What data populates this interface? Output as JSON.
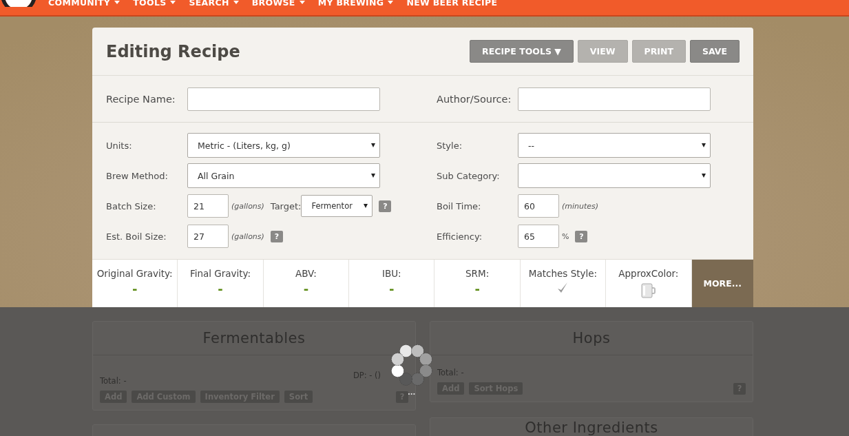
{
  "nav": {
    "items": [
      {
        "label": "COMMUNITY",
        "dropdown": true
      },
      {
        "label": "TOOLS",
        "dropdown": true
      },
      {
        "label": "SEARCH",
        "dropdown": true
      },
      {
        "label": "BROWSE",
        "dropdown": true
      },
      {
        "label": "MY BREWING",
        "dropdown": true
      },
      {
        "label": "NEW BEER RECIPE",
        "dropdown": false
      }
    ]
  },
  "editor": {
    "title": "Editing Recipe",
    "buttons": [
      {
        "label": "RECIPE TOOLS ▼",
        "disabled": false
      },
      {
        "label": "VIEW",
        "disabled": true
      },
      {
        "label": "PRINT",
        "disabled": true
      },
      {
        "label": "SAVE",
        "disabled": false
      }
    ],
    "name_row": [
      {
        "label": "Recipe Name:"
      },
      {
        "label": "Author/Source:"
      }
    ],
    "left_fields": [
      {
        "label": "Units:",
        "parts": [
          {
            "kind": "select",
            "value": "Metric - (Liters, kg, g)"
          }
        ]
      },
      {
        "label": "Brew Method:",
        "parts": [
          {
            "kind": "select",
            "value": "All Grain"
          }
        ]
      },
      {
        "label": "Batch Size:",
        "parts": [
          {
            "kind": "input",
            "value": "21"
          },
          {
            "kind": "unit",
            "text": "(gallons)"
          },
          {
            "kind": "label",
            "text": "Target:"
          },
          {
            "kind": "select",
            "value": "Fermentor"
          },
          {
            "kind": "help",
            "text": "?"
          }
        ]
      },
      {
        "label": "Est. Boil Size:",
        "parts": [
          {
            "kind": "input",
            "value": "27"
          },
          {
            "kind": "unit",
            "text": "(gallons)"
          },
          {
            "kind": "help",
            "text": "?"
          }
        ]
      }
    ],
    "right_fields": [
      {
        "label": "Style:",
        "parts": [
          {
            "kind": "select",
            "value": "--"
          }
        ]
      },
      {
        "label": "Sub Category:",
        "parts": [
          {
            "kind": "select"
          }
        ]
      },
      {
        "label": "Boil Time:",
        "parts": [
          {
            "kind": "input",
            "value": "60"
          },
          {
            "kind": "unit",
            "text": "(minutes)"
          }
        ]
      },
      {
        "label": "Efficiency:",
        "parts": [
          {
            "kind": "input",
            "value": "65"
          },
          {
            "kind": "suffix",
            "text": "%"
          },
          {
            "kind": "help",
            "text": "?"
          }
        ]
      }
    ],
    "stats": [
      {
        "label": "Original Gravity:",
        "kind": "text",
        "value": "-"
      },
      {
        "label": "Final Gravity:",
        "kind": "text",
        "value": "-"
      },
      {
        "label": "ABV:",
        "kind": "text",
        "value": "-"
      },
      {
        "label": "IBU:",
        "kind": "text",
        "value": "-"
      },
      {
        "label": "SRM:",
        "kind": "text",
        "value": "-"
      },
      {
        "label": "Matches Style:",
        "kind": "check"
      },
      {
        "label": "ApproxColor:",
        "kind": "mug"
      }
    ],
    "more_button": "MORE..."
  },
  "panels": {
    "left": [
      {
        "title": "Fermentables",
        "total_label": "Total:",
        "total_value": "-",
        "dp": "DP: - ()",
        "buttons": [
          "Add",
          "Add Custom",
          "Inventory Filter",
          "Sort"
        ],
        "help": "?"
      },
      {
        "kind": "empty"
      }
    ],
    "right": [
      {
        "title": "Hops",
        "total_label": "Total:",
        "total_value": "-",
        "buttons": [
          "Add",
          "Sort Hops"
        ],
        "help": "?"
      },
      {
        "title": "Other Ingredients",
        "kind": "title-only"
      }
    ]
  },
  "loading": {
    "text": "..."
  }
}
